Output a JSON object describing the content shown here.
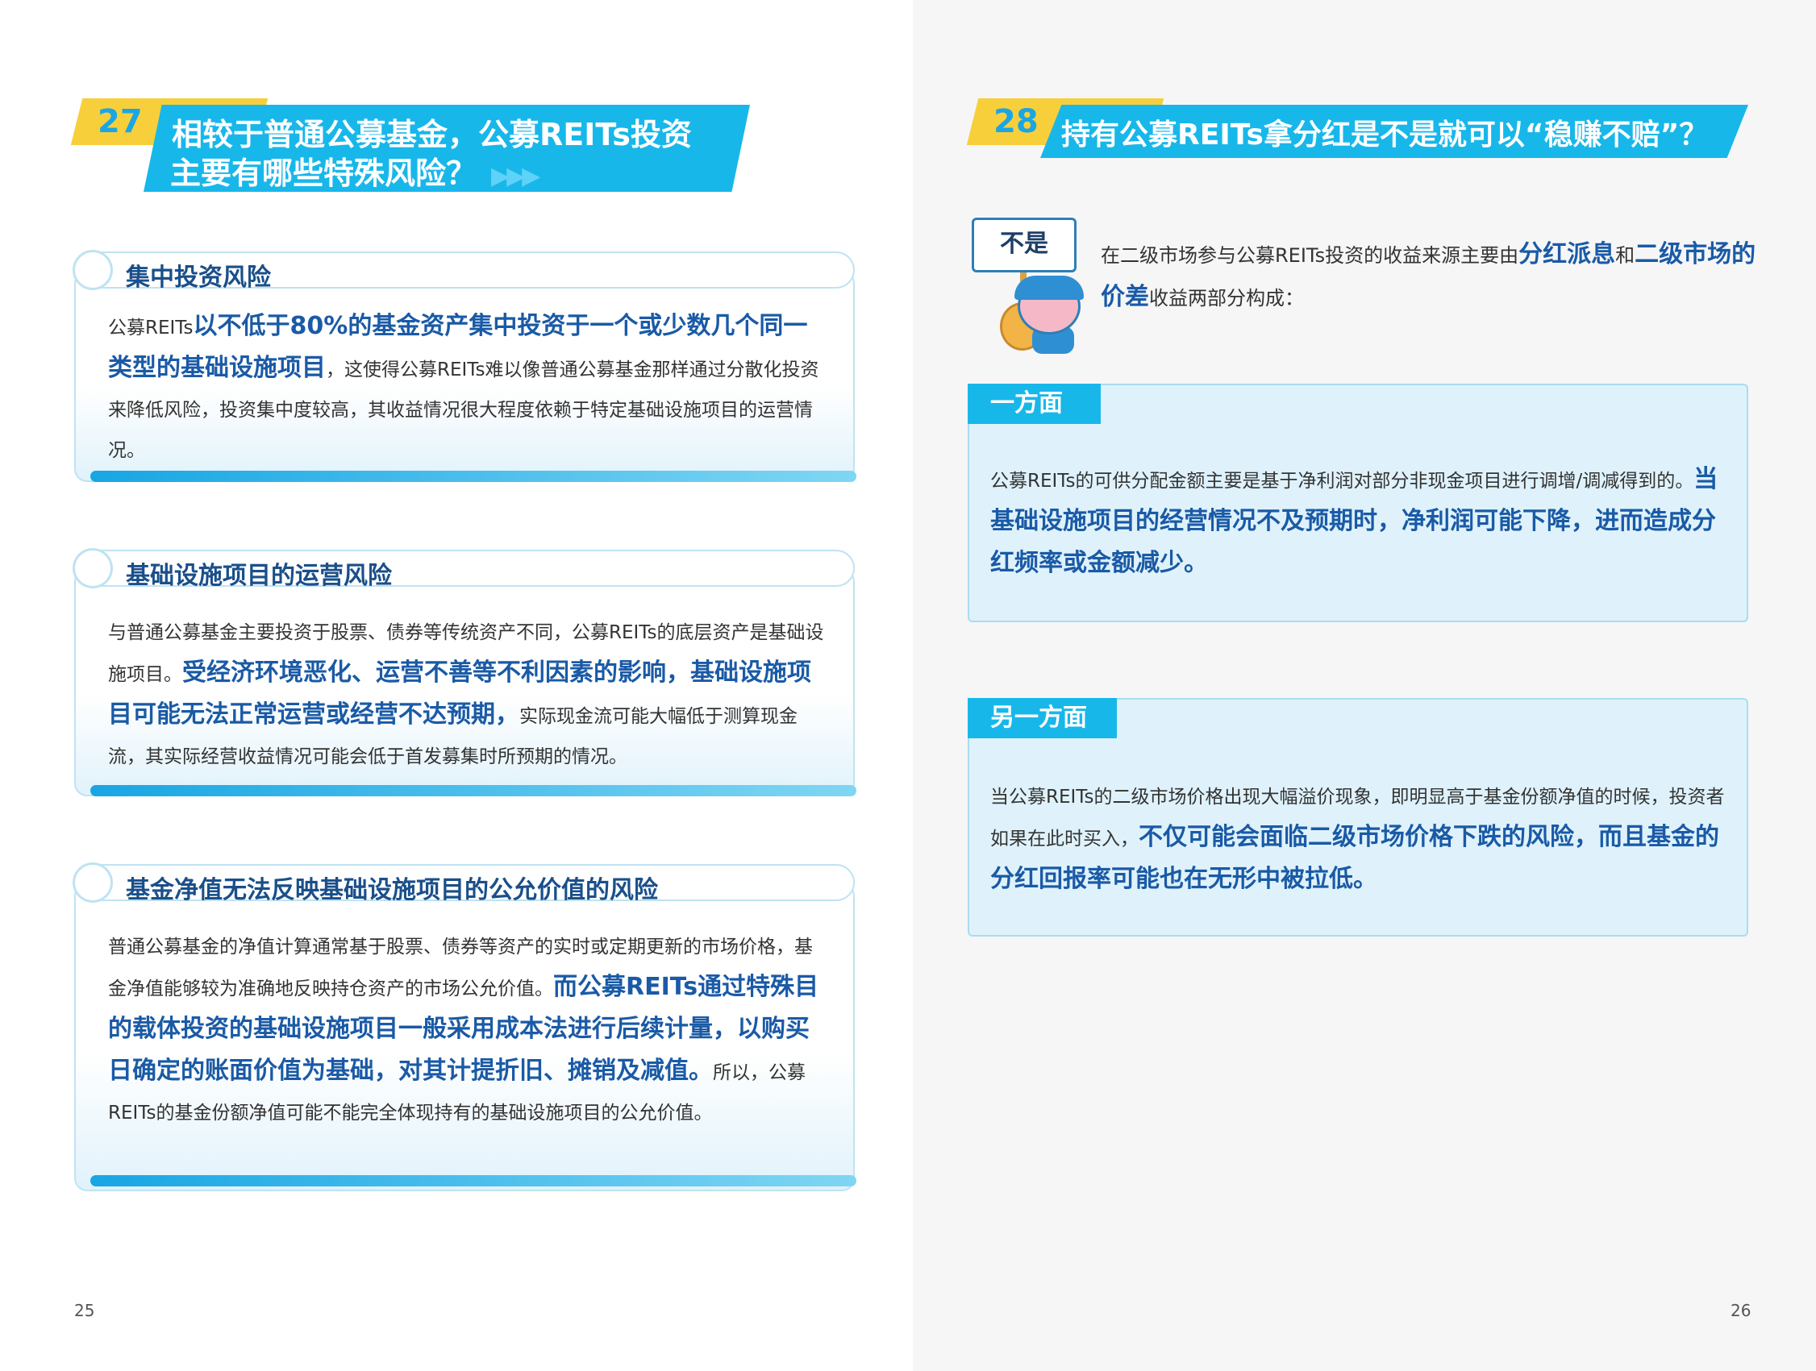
{
  "left_page": {
    "question_number": "27",
    "question_line1": "相较于普通公募基金，公募REITs投资",
    "question_line2": "主要有哪些特殊风险？",
    "question_arrows": "▶▶▶",
    "cards": [
      {
        "title": "集中投资风险",
        "body_parts": [
          {
            "t": "公募REITs",
            "b": false
          },
          {
            "t": "以不低于80%的基金资产集中投资于一个或少数几个同一类型的基础设施项目",
            "b": true
          },
          {
            "t": "，这使得公募REITs难以像普通公募基金那样通过分散化投资来降低风险，投资集中度较高，其收益情况很大程度依赖于特定基础设施项目的运营情况。",
            "b": false
          }
        ]
      },
      {
        "title": "基础设施项目的运营风险",
        "body_parts": [
          {
            "t": "与普通公募基金主要投资于股票、债券等传统资产不同，公募REITs的底层资产是基础设施项目。",
            "b": false
          },
          {
            "t": "受经济环境恶化、运营不善等不利因素的影响，基础设施项目可能无法正常运营或经营不达预期，",
            "b": true
          },
          {
            "t": "实际现金流可能大幅低于测算现金流，其实际经营收益情况可能会低于首发募集时所预期的情况。",
            "b": false
          }
        ]
      },
      {
        "title": "基金净值无法反映基础设施项目的公允价值的风险",
        "body_parts": [
          {
            "t": "普通公募基金的净值计算通常基于股票、债券等资产的实时或定期更新的市场价格，基金净值能够较为准确地反映持仓资产的市场公允价值。",
            "b": false
          },
          {
            "t": "而公募REITs通过特殊目的载体投资的基础设施项目一般采用成本法进行后续计量，以购买日确定的账面价值为基础，对其计提折旧、摊销及减值。",
            "b": true
          },
          {
            "t": "所以，公募REITs的基金份额净值可能不能完全体现持有的基础设施项目的公允价值。",
            "b": false
          }
        ]
      }
    ],
    "page_number": "25"
  },
  "right_page": {
    "question_number": "28",
    "question_text": "持有公募REITs拿分红是不是就可以“稳赚不赔”？",
    "sign_text": "不是",
    "intro_parts": [
      {
        "t": "在二级市场参与公募REITs投资的收益来源主要由",
        "b": false
      },
      {
        "t": "分红派息",
        "b": true
      },
      {
        "t": "和",
        "b": false
      },
      {
        "t": "二级市场的价差",
        "b": true
      },
      {
        "t": "收益两部分构成：",
        "b": false
      }
    ],
    "boxes": [
      {
        "tab": "一方面",
        "body_parts": [
          {
            "t": "公募REITs的可供分配金额主要是基于净利润对部分非现金项目进行调增/调减得到的。",
            "b": false
          },
          {
            "t": "当基础设施项目的经营情况不及预期时，净利润可能下降，进而造成分红频率或金额减少。",
            "b": true
          }
        ]
      },
      {
        "tab": "另一方面",
        "body_parts": [
          {
            "t": "当公募REITs的二级市场价格出现大幅溢价现象，即明显高于基金份额净值的时候，投资者如果在此时买入，",
            "b": false
          },
          {
            "t": "不仅可能会面临二级市场价格下跌的风险，而且基金的分红回报率可能也在无形中被拉低。",
            "b": true
          }
        ]
      }
    ],
    "page_number": "26"
  },
  "colors": {
    "banner_blue": "#18b7ea",
    "number_yellow": "#f7cf3b",
    "emphasis_blue": "#1a5aa6",
    "title_blue": "#1a4f8a"
  }
}
